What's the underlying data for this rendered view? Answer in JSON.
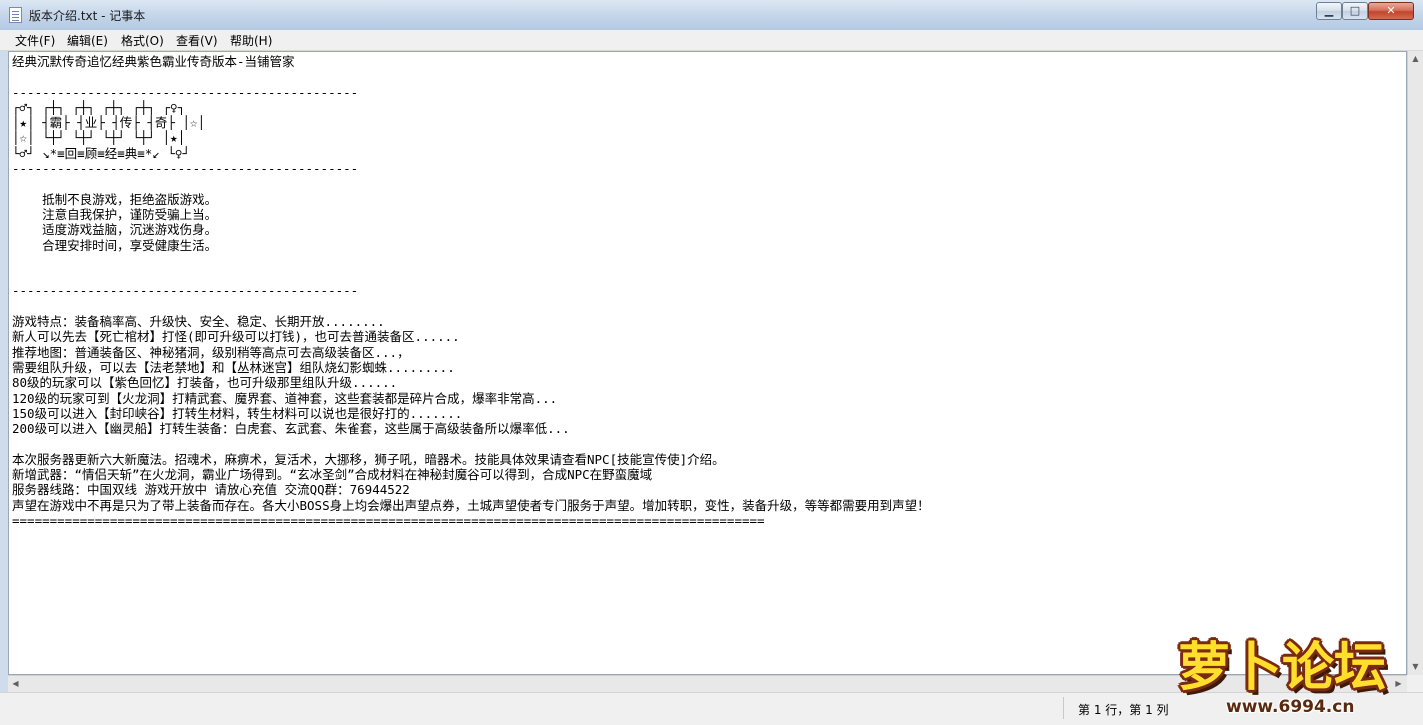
{
  "window": {
    "title": "版本介绍.txt - 记事本",
    "buttons": {
      "minimize": "▁",
      "maximize": "□",
      "close": "✕"
    }
  },
  "menu": [
    "文件(F)",
    "编辑(E)",
    "格式(O)",
    "查看(V)",
    "帮助(H)"
  ],
  "document": {
    "lines": [
      "经典沉默传奇追忆经典紫色霸业传奇版本-当铺管家",
      "",
      "----------------------------------------------",
      "┌♂┐ ┌┼┐ ┌┼┐ ┌┼┐ ┌┼┐ ┌♀┐",
      "│★│ ┤霸├ ┤业├ ┤传├ ┤奇├ │☆│",
      "│☆│ └┼┘ └┼┘ └┼┘ └┼┘ │★│",
      "└♂┘ ↘*≡回≡顾≡经≡典≡*↙ └♀┘",
      "----------------------------------------------",
      "",
      "    抵制不良游戏，拒绝盗版游戏。",
      "    注意自我保护，谨防受骗上当。",
      "    适度游戏益脑，沉迷游戏伤身。",
      "    合理安排时间，享受健康生活。",
      "",
      "",
      "----------------------------------------------",
      "",
      "游戏特点：装备稿率高、升级快、安全、稳定、长期开放........",
      "新人可以先去【死亡棺材】打怪(即可升级可以打钱)，也可去普通装备区......",
      "推荐地图：普通装备区、神秘猪洞，级别稍等高点可去高级装备区...，",
      "需要组队升级，可以去【法老禁地】和【丛林迷宫】组队烧幻影蜘蛛.........",
      "80级的玩家可以【紫色回忆】打装备，也可升级那里组队升级......",
      "120级的玩家可到【火龙洞】打精武套、魔界套、道神套，这些套装都是碎片合成，爆率非常高...",
      "150级可以进入【封印峡谷】打转生材料，转生材料可以说也是很好打的.......",
      "200级可以进入【幽灵船】打转生装备：白虎套、玄武套、朱雀套，这些属于高级装备所以爆率低...",
      "",
      "本次服务器更新六大新魔法。招魂术，麻痹术，复活术，大挪移，狮子吼，暗器术。技能具体效果请查看NPC[技能宣传使]介绍。",
      "新增武器：“情侣天斩”在火龙洞，霸业广场得到。“玄冰圣剑”合成材料在神秘封魔谷可以得到，合成NPC在野蛮魔域",
      "服务器线路：中国双线 游戏开放中 请放心充值 交流QQ群：76944522",
      "声望在游戏中不再是只为了带上装备而存在。各大小BOSS身上均会爆出声望点券，土城声望使者专门服务于声望。增加转职，变性，装备升级，等等都需要用到声望！",
      "===================================================================================================="
    ]
  },
  "status": {
    "position": "第 1 行，第 1 列"
  },
  "watermark": {
    "brand": "萝卜论坛",
    "url": "www.6994.cn"
  }
}
